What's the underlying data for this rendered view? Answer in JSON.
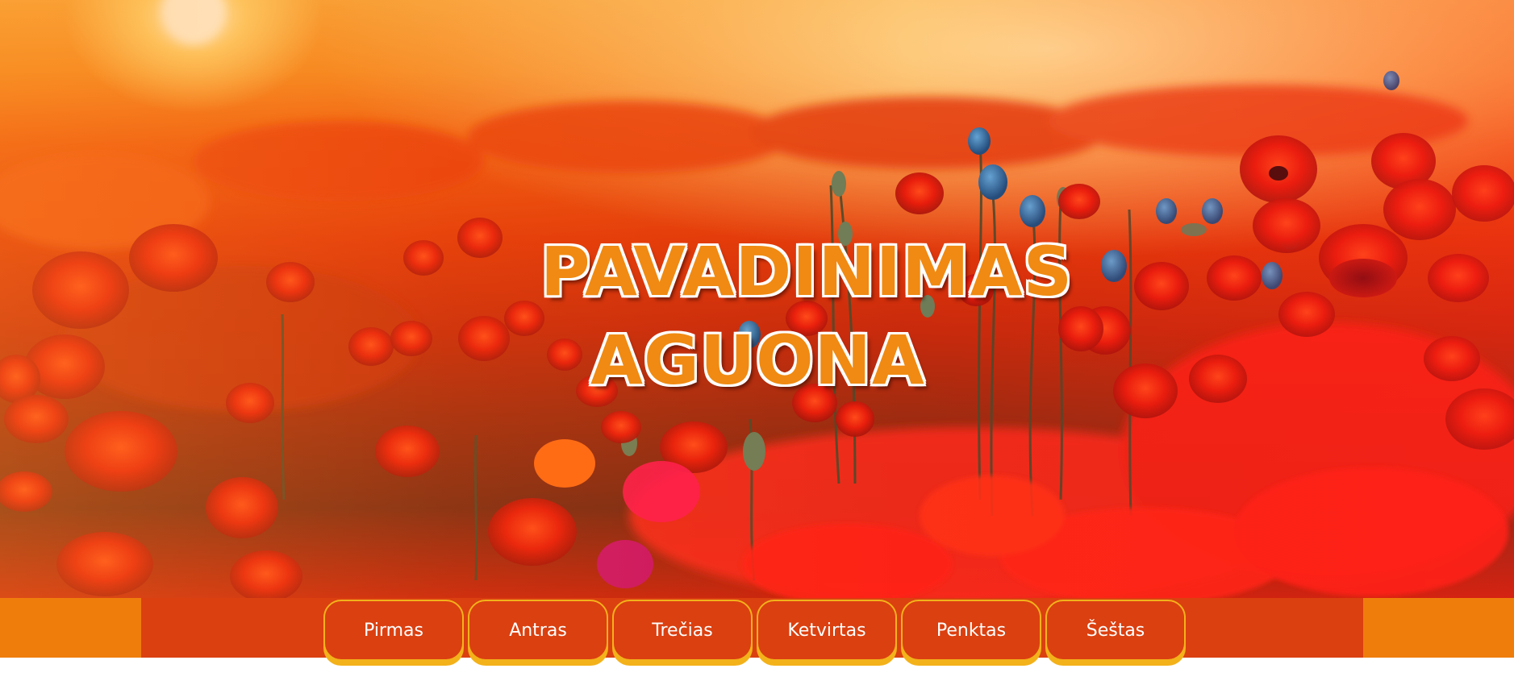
{
  "hero": {
    "title_line1": "PAVADINIMAS",
    "title_line2": "AGUONA"
  },
  "nav": {
    "items": [
      {
        "label": "Pirmas"
      },
      {
        "label": "Antras"
      },
      {
        "label": "Trečias"
      },
      {
        "label": "Ketvirtas"
      },
      {
        "label": "Penktas"
      },
      {
        "label": "Šeštas"
      }
    ]
  },
  "colors": {
    "title": "#f08a12",
    "title_outline": "#ffffff",
    "nav_outer": "#ef7d0c",
    "nav_inner": "#db4010",
    "nav_button_border": "#f3b21a",
    "nav_text": "#ffffff"
  }
}
